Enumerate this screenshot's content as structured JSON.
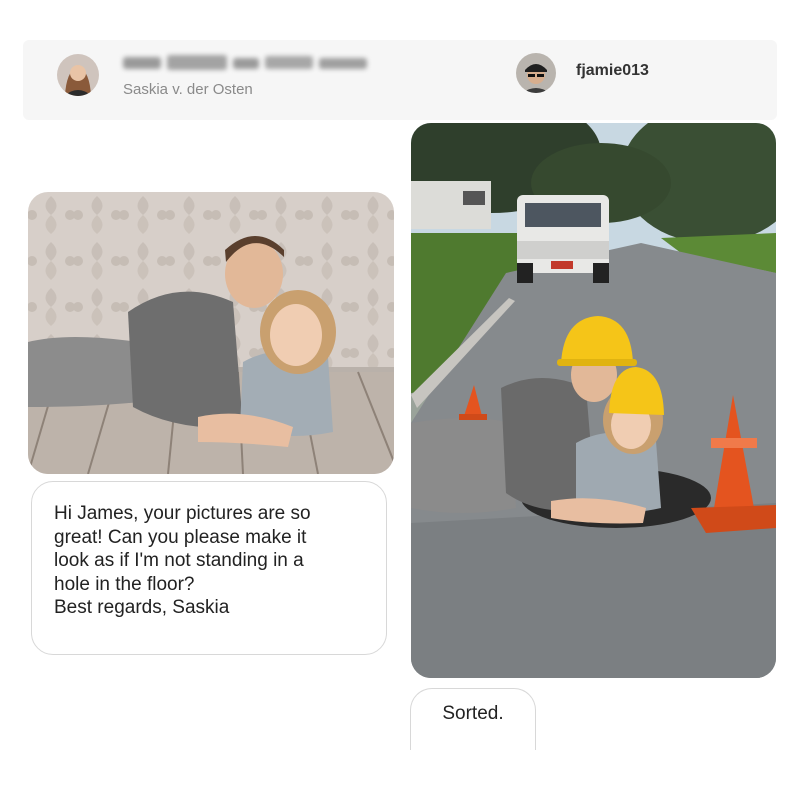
{
  "conversation": {
    "sender": {
      "name": "[blurred]",
      "display_name": "Saskia v. der Osten",
      "avatar_icon": "user-avatar-woman"
    },
    "recipient": {
      "username": "fjamie013",
      "avatar_icon": "user-avatar-man-with-cap"
    },
    "original_photo": {
      "description_icon": "couple-lying-on-wood-floor-photo"
    },
    "message": {
      "text": "Hi James, your pictures are so\ngreat! Can you please make it\nlook as if I'm not standing in a\nhole in the floor?\nBest regards, Saskia"
    },
    "edited_photo": {
      "description_icon": "couple-in-street-manhole-photo"
    },
    "reply": {
      "text": "Sorted."
    }
  },
  "colors": {
    "header_bg": "#f6f6f6",
    "bubble_border": "#d8d8d8",
    "text": "#222222",
    "muted_text": "#8a8a8a",
    "hardhat_yellow": "#f5c518",
    "cone_orange": "#e4541f"
  }
}
